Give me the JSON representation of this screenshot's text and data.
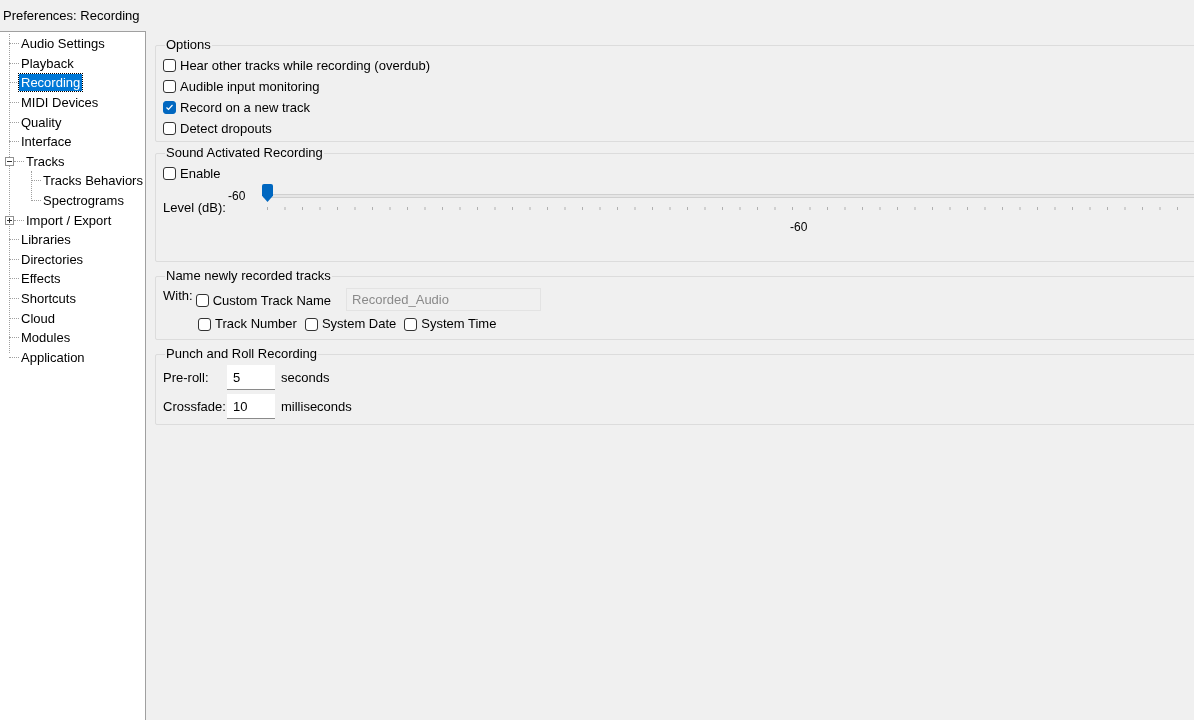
{
  "window": {
    "title": "Preferences: Recording"
  },
  "sidebar": {
    "items": [
      {
        "label": "Audio Settings",
        "selected": false
      },
      {
        "label": "Playback",
        "selected": false
      },
      {
        "label": "Recording",
        "selected": true
      },
      {
        "label": "MIDI Devices",
        "selected": false
      },
      {
        "label": "Quality",
        "selected": false
      },
      {
        "label": "Interface",
        "selected": false
      },
      {
        "label": "Tracks",
        "selected": false,
        "expanded": true,
        "children": [
          {
            "label": "Tracks Behaviors",
            "selected": false
          },
          {
            "label": "Spectrograms",
            "selected": false
          }
        ]
      },
      {
        "label": "Import / Export",
        "selected": false,
        "expanded": false
      },
      {
        "label": "Libraries",
        "selected": false
      },
      {
        "label": "Directories",
        "selected": false
      },
      {
        "label": "Effects",
        "selected": false
      },
      {
        "label": "Shortcuts",
        "selected": false
      },
      {
        "label": "Cloud",
        "selected": false
      },
      {
        "label": "Modules",
        "selected": false
      },
      {
        "label": "Application",
        "selected": false
      }
    ]
  },
  "options": {
    "title": "Options",
    "checkboxes": [
      {
        "label": "Hear other tracks while recording (overdub)",
        "checked": false
      },
      {
        "label": "Audible input monitoring",
        "checked": false
      },
      {
        "label": "Record on a new track",
        "checked": true
      },
      {
        "label": "Detect dropouts",
        "checked": false
      }
    ]
  },
  "sound_activated": {
    "title": "Sound Activated Recording",
    "enable": {
      "label": "Enable",
      "checked": false
    },
    "slider": {
      "label": "Level (dB):",
      "value": "-60",
      "level": 0,
      "scale_label": "-60"
    }
  },
  "name_tracks": {
    "title": "Name newly recorded tracks",
    "with_label": "With:",
    "custom": {
      "label": "Custom Track Name",
      "checked": false,
      "value": "Recorded_Audio",
      "disabled": true
    },
    "options": [
      {
        "label": "Track Number",
        "checked": false
      },
      {
        "label": "System Date",
        "checked": false
      },
      {
        "label": "System Time",
        "checked": false
      }
    ]
  },
  "punch_roll": {
    "title": "Punch and Roll Recording",
    "fields": [
      {
        "label": "Pre-roll:",
        "value": "5",
        "unit": "seconds"
      },
      {
        "label": "Crossfade:",
        "value": "10",
        "unit": "milliseconds"
      }
    ]
  }
}
